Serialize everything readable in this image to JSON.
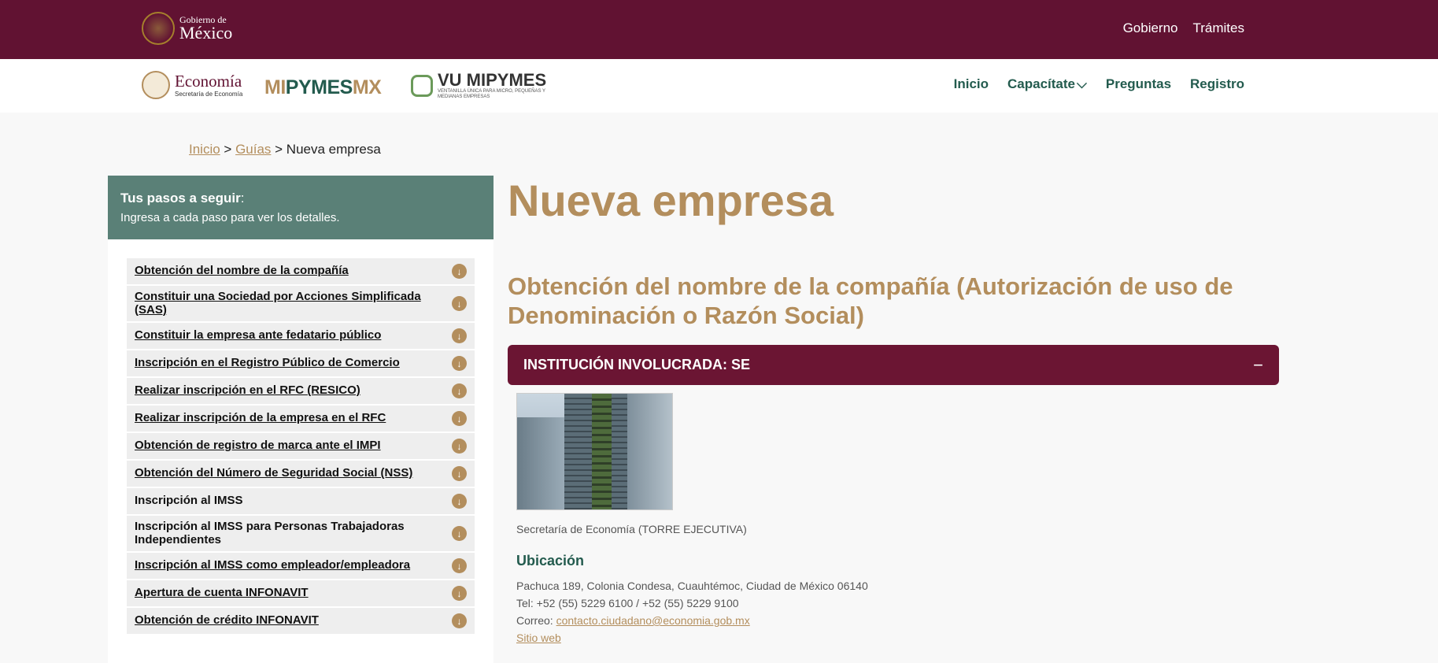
{
  "gov_header": {
    "logo_small": "Gobierno de",
    "logo_big": "México",
    "nav": [
      "Gobierno",
      "Trámites"
    ]
  },
  "sub_header": {
    "economia_big": "Economía",
    "economia_small": "Secretaría de Economía",
    "mipymes_part1": "MI",
    "mipymes_part2": "PYMES",
    "mipymes_part3": "MX",
    "vu_big": "VU MIPYMES",
    "vu_small": "VENTANILLA ÚNICA PARA MICRO, PEQUEÑAS Y MEDIANAS EMPRESAS",
    "nav": {
      "inicio": "Inicio",
      "capacitate": "Capacítate",
      "preguntas": "Preguntas",
      "registro": "Registro"
    }
  },
  "breadcrumb": {
    "home": "Inicio",
    "sep1": " > ",
    "guias": "Guías",
    "sep2": " > ",
    "current": "Nueva empresa"
  },
  "sidebar": {
    "title": "Tus pasos a seguir",
    "title_colon": ":",
    "subtitle": "Ingresa a cada paso para ver los detalles.",
    "steps": [
      {
        "label": "Obtención del nombre de la compañía",
        "underline": true
      },
      {
        "label": "Constituir una Sociedad por Acciones Simplificada (SAS)",
        "underline": true
      },
      {
        "label": "Constituir la empresa ante fedatario público",
        "underline": true
      },
      {
        "label": "Inscripción en el Registro Público de Comercio",
        "underline": true
      },
      {
        "label": "Realizar inscripción en el RFC (RESICO)",
        "underline": true
      },
      {
        "label": "Realizar inscripción de la empresa en el RFC",
        "underline": true
      },
      {
        "label": "Obtención de registro de marca ante el IMPI",
        "underline": true
      },
      {
        "label": "Obtención del Número de Seguridad Social (NSS)",
        "underline": true
      },
      {
        "label": "Inscripción al IMSS",
        "underline": false
      },
      {
        "label": "Inscripción al IMSS para Personas Trabajadoras Independientes",
        "underline": false
      },
      {
        "label": "Inscripción al IMSS como empleador/empleadora",
        "underline": true
      },
      {
        "label": "Apertura de cuenta INFONAVIT",
        "underline": true
      },
      {
        "label": "Obtención de crédito INFONAVIT",
        "underline": true
      }
    ]
  },
  "main": {
    "title": "Nueva empresa",
    "section_title": "Obtención del nombre de la compañía (Autorización de uso de Denominación o Razón Social)",
    "institution_label": "INSTITUCIÓN INVOLUCRADA: SE",
    "collapse_symbol": "−",
    "photo_caption": "Secretaría de Economía (TORRE EJECUTIVA)",
    "location_heading": "Ubicación",
    "address": "Pachuca 189, Colonia Condesa, Cuauhtémoc, Ciudad de México 06140",
    "tel": "Tel: +52 (55) 5229 6100 / +52 (55) 5229 9100",
    "email_prefix": "Correo: ",
    "email": "contacto.ciudadano@economia.gob.mx",
    "website": "Sitio web"
  },
  "colors": {
    "gov_bar": "#611232",
    "gold": "#b38e5d",
    "green": "#235b4e",
    "sidebar_head": "#5a8077",
    "institution_bar": "#6b1533"
  }
}
